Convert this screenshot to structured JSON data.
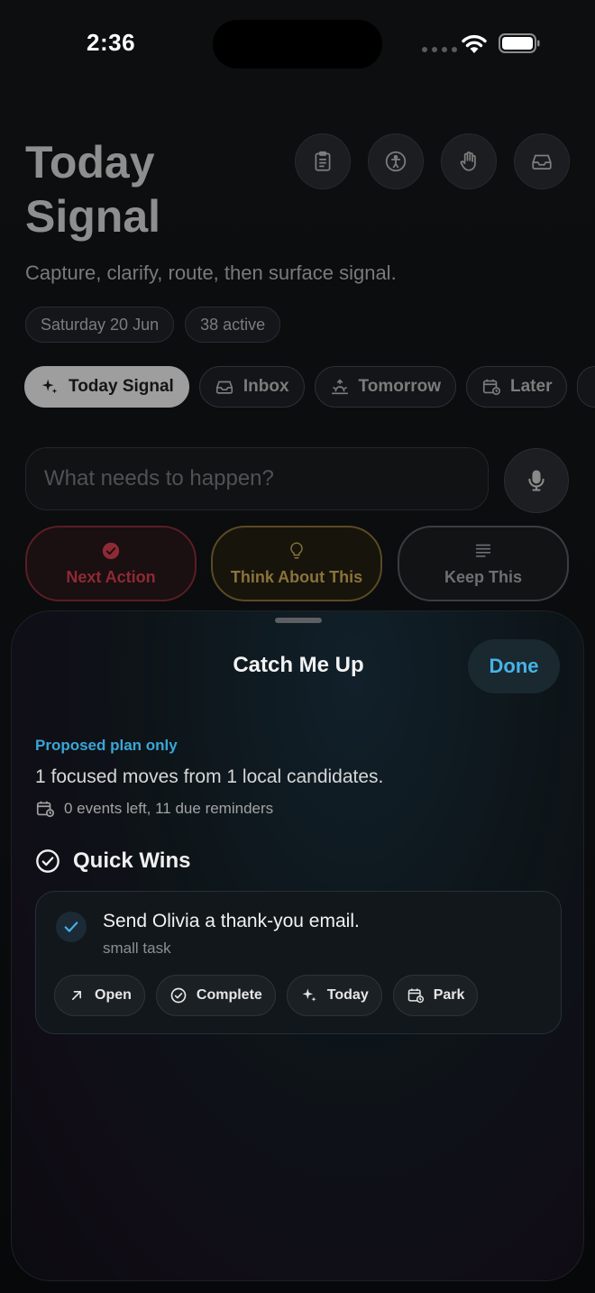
{
  "status_bar": {
    "time": "2:36"
  },
  "header": {
    "title": "Today Signal",
    "subtitle": "Capture, clarify, route, then surface signal.",
    "icons": [
      "clipboard-icon",
      "accessibility-icon",
      "hand-icon",
      "inbox-tray-icon"
    ],
    "chips": {
      "date": "Saturday 20 Jun",
      "active_count": "38 active"
    }
  },
  "filters": [
    {
      "label": "Today Signal",
      "icon": "sparkle-icon",
      "active": true
    },
    {
      "label": "Inbox",
      "icon": "inbox-tray-icon",
      "active": false
    },
    {
      "label": "Tomorrow",
      "icon": "sunrise-icon",
      "active": false
    },
    {
      "label": "Later",
      "icon": "calendar-clock-icon",
      "active": false
    }
  ],
  "capture": {
    "placeholder": "What needs to happen?"
  },
  "route_buttons": {
    "next_action": "Next Action",
    "think_about": "Think About This",
    "keep": "Keep This"
  },
  "colors": {
    "accent_blue": "#45b4e8",
    "next_red": "#8e2a34",
    "think_gold": "#8a733b"
  },
  "sheet": {
    "title": "Catch Me Up",
    "done_label": "Done",
    "proposed_label": "Proposed plan only",
    "summary": "1 focused moves from 1 local candidates.",
    "meta": "0 events left, 11 due reminders",
    "section_title": "Quick Wins",
    "task": {
      "title": "Send Olivia a thank-you email.",
      "subtitle": "small task",
      "actions": {
        "open": "Open",
        "complete": "Complete",
        "today": "Today",
        "park": "Park"
      }
    }
  }
}
